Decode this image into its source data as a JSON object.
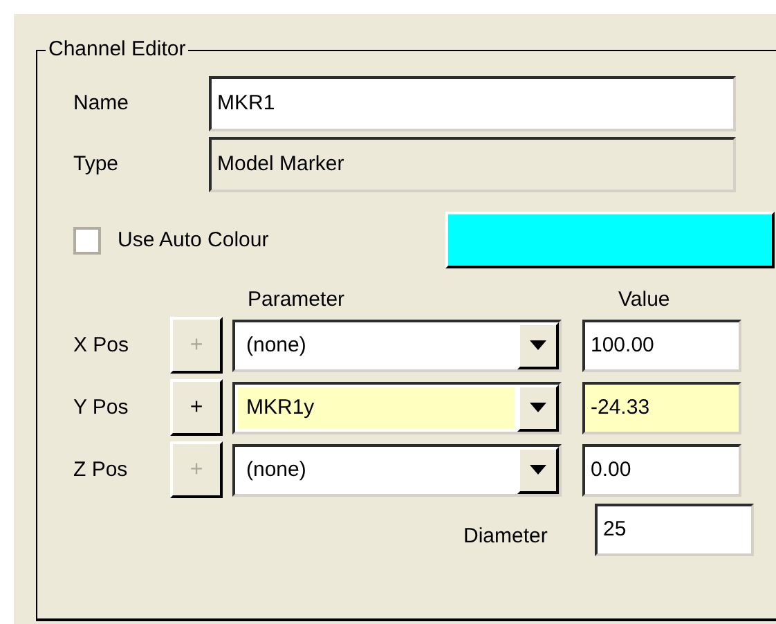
{
  "group": {
    "title": "Channel Editor"
  },
  "name": {
    "label": "Name",
    "value": "MKR1"
  },
  "type": {
    "label": "Type",
    "value": "Model Marker",
    "disabled": true
  },
  "auto_colour": {
    "label": "Use Auto Colour",
    "checked": false
  },
  "colour_swatch": {
    "color": "#00ffff"
  },
  "headers": {
    "parameter": "Parameter",
    "value": "Value"
  },
  "rows": [
    {
      "label": "X Pos",
      "plus": "+",
      "plus_enabled": false,
      "parameter": "(none)",
      "value": "100.00",
      "highlighted": false
    },
    {
      "label": "Y Pos",
      "plus": "+",
      "plus_enabled": true,
      "parameter": "MKR1y",
      "value": "-24.33",
      "highlighted": true
    },
    {
      "label": "Z Pos",
      "plus": "+",
      "plus_enabled": false,
      "parameter": "(none)",
      "value": "0.00",
      "highlighted": false
    }
  ],
  "diameter": {
    "label": "Diameter",
    "value": "25"
  }
}
